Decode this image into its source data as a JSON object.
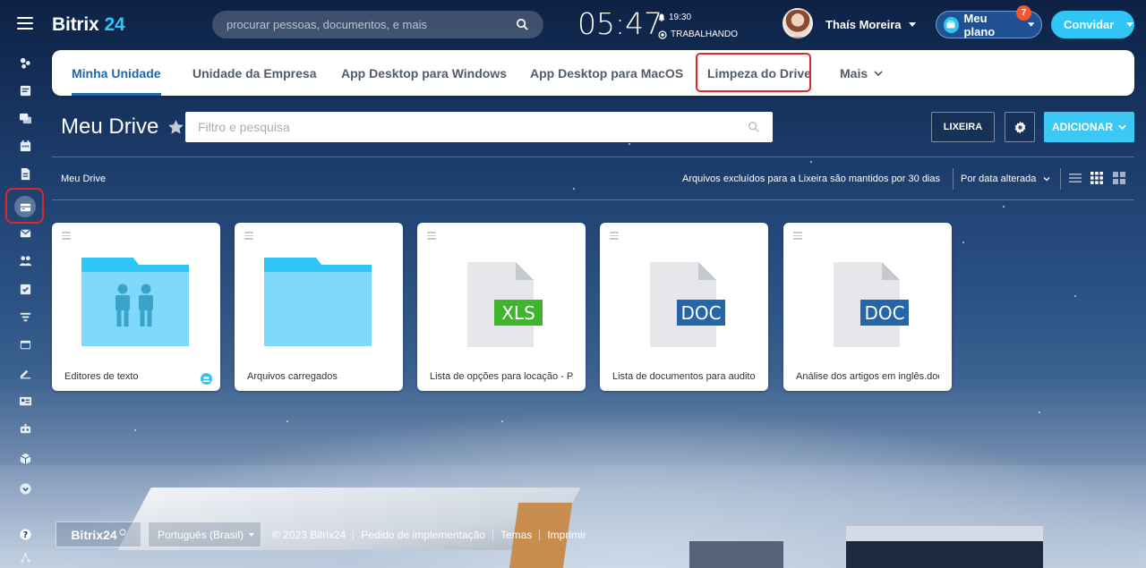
{
  "header": {
    "brand": "Bitrix",
    "brand_num": "24",
    "search_placeholder": "procurar pessoas, documentos, e mais",
    "clock_time": "05:47",
    "alarm_time": "19:30",
    "work_status": "TRABALHANDO",
    "user_name": "Thaís Moreira",
    "plan_label": "Meu plano",
    "plan_badge": "7",
    "invite_label": "Convidar"
  },
  "tabs": [
    {
      "label": "Minha Unidade",
      "active": true
    },
    {
      "label": "Unidade da Empresa"
    },
    {
      "label": "App Desktop para Windows"
    },
    {
      "label": "App Desktop para MacOS"
    },
    {
      "label": "Limpeza do Drive",
      "highlighted": true
    },
    {
      "label": "Mais"
    }
  ],
  "page": {
    "title": "Meu Drive",
    "filter_placeholder": "Filtro e pesquisa",
    "trash_button": "LIXEIRA",
    "add_button": "ADICIONAR",
    "breadcrumb": "Meu Drive",
    "retention_note": "Arquivos excluídos para a Lixeira são mantidos por 30 dias",
    "sort_label": "Por data alterada"
  },
  "files": [
    {
      "name": "Editores de texto",
      "kind": "shared-folder"
    },
    {
      "name": "Arquivos carregados",
      "kind": "folder"
    },
    {
      "name": "Lista de opções para locação - P...",
      "kind": "file",
      "badge": "XLS"
    },
    {
      "name": "Lista de documentos para audito...",
      "kind": "file",
      "badge": "DOC"
    },
    {
      "name": "Análise dos artigos em inglês.docx",
      "kind": "file",
      "badge": "DOC"
    }
  ],
  "footer": {
    "logo": "Bitrix24",
    "language": "Português (Brasil)",
    "copyright": "© 2023 Bitrix24",
    "links": [
      "Pedido de implementação",
      "Temas",
      "Imprimir"
    ]
  },
  "colors": {
    "accent": "#2fc6f6",
    "active_tab": "#2067b0",
    "highlight": "#e0262a",
    "xls": "#3fb42d",
    "doc": "#2466a8",
    "folder": "#2fc6f6"
  }
}
